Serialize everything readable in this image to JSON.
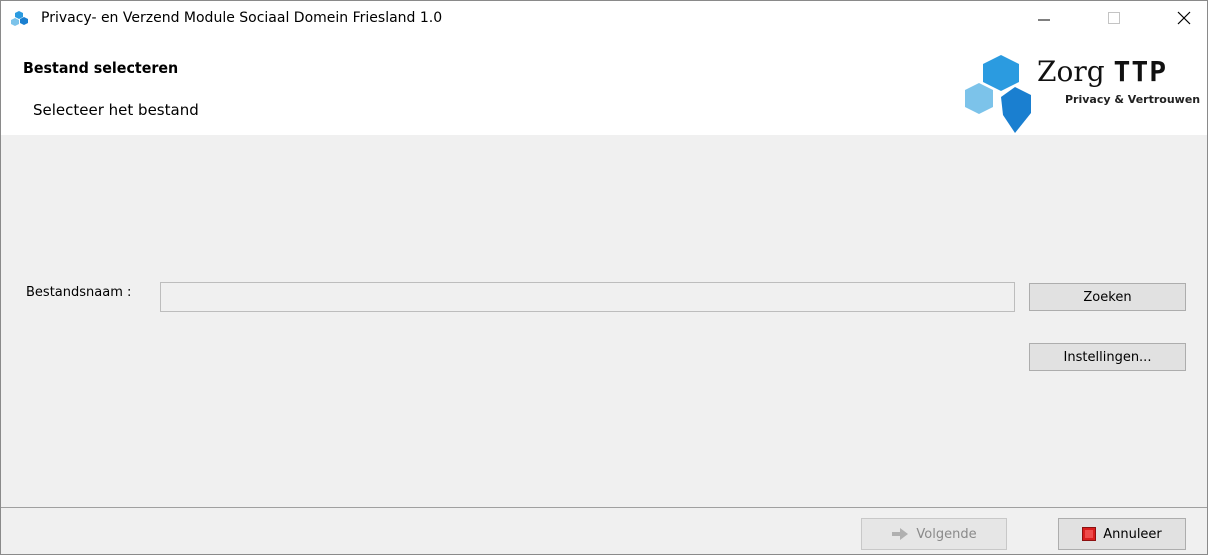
{
  "window": {
    "title": "Privacy- en Verzend Module Sociaal Domein Friesland 1.0",
    "icon": "app-cubes-icon",
    "controls": [
      "minimize-icon",
      "maximize-icon",
      "close-icon"
    ]
  },
  "header": {
    "title": "Bestand selecteren",
    "subtitle": "Selecteer het bestand",
    "logo": {
      "word_prefix": "Zorg",
      "word_bold": "TTP",
      "tagline": "Privacy & Vertrouwen"
    }
  },
  "form": {
    "filename_label": "Bestandsnaam :",
    "filename_value": "",
    "search_label": "Zoeken",
    "settings_label": "Instellingen..."
  },
  "footer": {
    "next_label": "Volgende",
    "next_icon": "arrow-right-icon",
    "next_enabled": false,
    "cancel_label": "Annuleer",
    "cancel_icon": "stop-icon"
  },
  "colors": {
    "logo_blue_dark": "#1a7fd0",
    "logo_blue_mid": "#2b9be0",
    "logo_blue_light": "#7cc3ea",
    "cancel_red": "#d91e1e",
    "panel_bg": "#f0f0f0"
  }
}
